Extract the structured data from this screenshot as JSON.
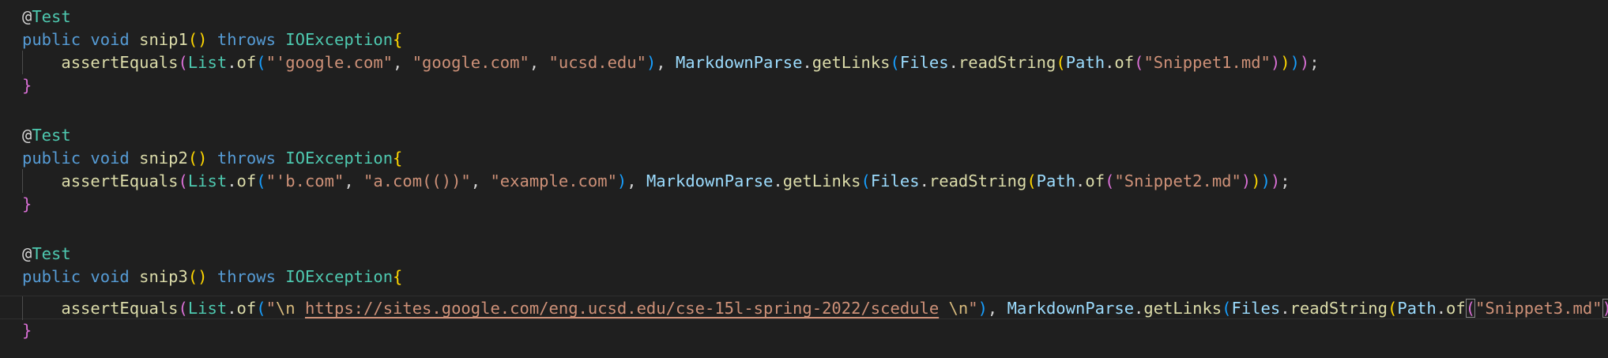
{
  "code": {
    "blocks": [
      {
        "annotation": "Test",
        "sig_public": "public",
        "sig_void": "void",
        "method": "snip1",
        "sig_parens": "()",
        "sig_throws": "throws",
        "exception": "IOException",
        "open_brace": "{",
        "assert_fn": "assertEquals",
        "list_type": "List",
        "of_fn": "of",
        "items": [
          "\"'google.com\"",
          "\"google.com\"",
          "\"ucsd.edu\""
        ],
        "parse_class": "MarkdownParse",
        "getlinks_fn": "getLinks",
        "files_class": "Files",
        "readstring_fn": "readString",
        "path_class": "Path",
        "path_of_fn": "of",
        "file_arg": "\"Snippet1.md\"",
        "close_brace": "}"
      },
      {
        "annotation": "Test",
        "sig_public": "public",
        "sig_void": "void",
        "method": "snip2",
        "sig_parens": "()",
        "sig_throws": "throws",
        "exception": "IOException",
        "open_brace": "{",
        "assert_fn": "assertEquals",
        "list_type": "List",
        "of_fn": "of",
        "items": [
          "\"'b.com\"",
          "\"a.com(())\"",
          "\"example.com\""
        ],
        "parse_class": "MarkdownParse",
        "getlinks_fn": "getLinks",
        "files_class": "Files",
        "readstring_fn": "readString",
        "path_class": "Path",
        "path_of_fn": "of",
        "file_arg": "\"Snippet2.md\"",
        "close_brace": "}"
      },
      {
        "annotation": "Test",
        "sig_public": "public",
        "sig_void": "void",
        "method": "snip3",
        "sig_parens": "()",
        "sig_throws": "throws",
        "exception": "IOException",
        "open_brace": "{",
        "assert_fn": "assertEquals",
        "list_type": "List",
        "of_fn": "of",
        "str_quote_open": "\"",
        "esc_newline_1": "\\n",
        "url": "https://sites.google.com/eng.ucsd.edu/cse-15l-spring-2022/scedule",
        "esc_newline_2": "\\n",
        "str_quote_close": "\"",
        "parse_class": "MarkdownParse",
        "getlinks_fn": "getLinks",
        "files_class": "Files",
        "readstring_fn": "readString",
        "path_class": "Path",
        "path_of_fn": "of",
        "file_arg": "\"Snippet3.md\"",
        "close_brace": "}"
      }
    ]
  },
  "colors": {
    "background": "#1f1f1f",
    "keyword": "#569cd6",
    "function": "#dcdcaa",
    "type": "#4ec9b0",
    "string": "#ce9178",
    "variable": "#9cdcfe",
    "bracket_level1": "#ffd700",
    "bracket_level2": "#da70d6",
    "bracket_level3": "#179fff"
  }
}
